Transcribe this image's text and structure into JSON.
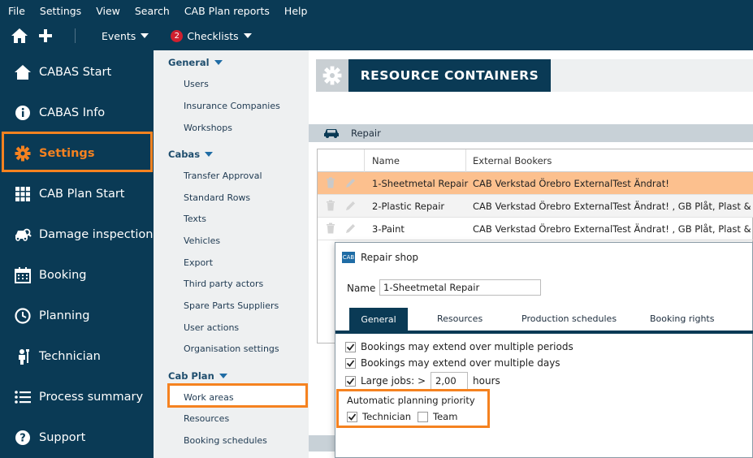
{
  "menubar": {
    "items": [
      "File",
      "Settings",
      "View",
      "Search",
      "CAB Plan reports",
      "Help"
    ]
  },
  "toolbar": {
    "home_icon": "home-icon",
    "add_icon": "plus-icon",
    "events_label": "Events",
    "checklists_badge": "2",
    "checklists_label": "Checklists"
  },
  "sidebar": {
    "items": [
      {
        "label": "CABAS Start",
        "icon": "home-icon"
      },
      {
        "label": "CABAS Info",
        "icon": "info-icon"
      },
      {
        "label": "Settings",
        "icon": "gear-icon",
        "active": true
      },
      {
        "label": "CAB Plan Start",
        "icon": "grid-icon"
      },
      {
        "label": "Damage inspection",
        "icon": "car-search-icon"
      },
      {
        "label": "Booking",
        "icon": "calendar-icon"
      },
      {
        "label": "Planning",
        "icon": "clock-icon"
      },
      {
        "label": "Technician",
        "icon": "wrench-person-icon"
      },
      {
        "label": "Process summary",
        "icon": "list-icon"
      },
      {
        "label": "Support",
        "icon": "question-icon"
      }
    ]
  },
  "subnav": {
    "general_header": "General",
    "general_items": [
      "Users",
      "Insurance Companies",
      "Workshops"
    ],
    "cabas_header": "Cabas",
    "cabas_items": [
      "Transfer Approval",
      "Standard Rows",
      "Texts",
      "Vehicles",
      "Export",
      "Third party actors",
      "Spare Parts Suppliers",
      "User actions",
      "Organisation settings"
    ],
    "cabplan_header": "Cab Plan",
    "cabplan_items": [
      "Work areas",
      "Resources",
      "Booking schedules"
    ]
  },
  "main": {
    "title": "RESOURCE CONTAINERS",
    "section": "Repair",
    "columns": [
      "Name",
      "External Bookers"
    ],
    "rows": [
      {
        "name": "1-Sheetmetal Repair",
        "bookers": "CAB Verkstad Örebro ExternalTest Ändrat!",
        "selected": true
      },
      {
        "name": "2-Plastic Repair",
        "bookers": "CAB Verkstad Örebro ExternalTest Ändrat! , GB Plåt, Plast & Lack,"
      },
      {
        "name": "3-Paint",
        "bookers": "CAB Verkstad Örebro ExternalTest Ändrat! , GB Plåt, Plast & Lack,"
      }
    ]
  },
  "dialog": {
    "title": "Repair shop",
    "logo_text": "CAB",
    "name_label": "Name",
    "name_value": "1-Sheetmetal Repair",
    "tabs": [
      "General",
      "Resources",
      "Production schedules",
      "Booking rights"
    ],
    "opt_multi_periods": "Bookings may extend over multiple periods",
    "opt_multi_days": "Bookings may extend over multiple days",
    "opt_large_jobs": "Large jobs: >",
    "large_jobs_value": "2,00",
    "hours_label": "hours",
    "priority_label": "Automatic planning priority",
    "priority_technician": "Technician",
    "priority_team": "Team"
  },
  "colors": {
    "navy": "#0a3a55",
    "orange": "#f58220",
    "selected_row": "#fcc08e"
  }
}
